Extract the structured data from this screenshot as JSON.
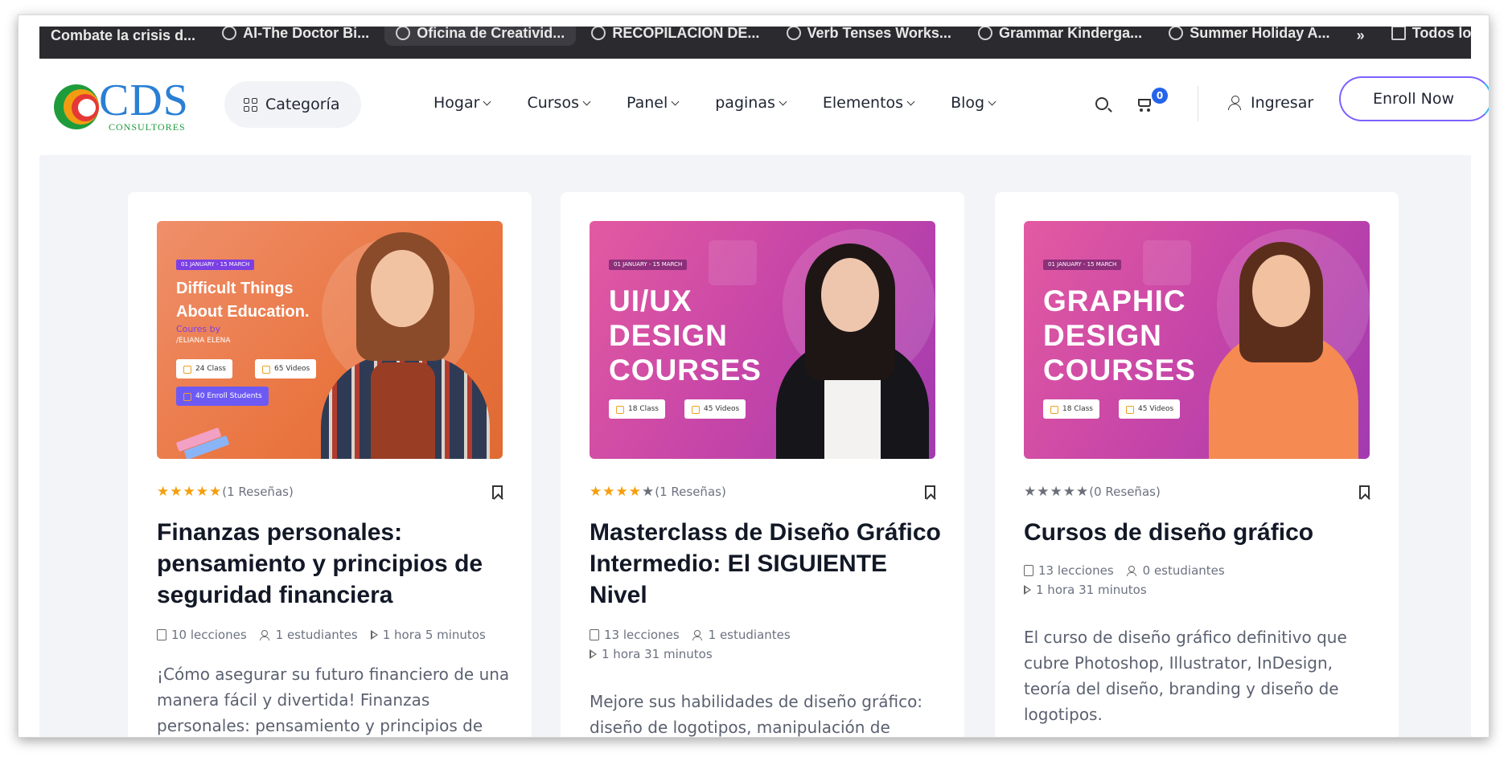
{
  "bookmarks": [
    {
      "label": "Combate la crisis d..."
    },
    {
      "label": "AI-The Doctor Bi..."
    },
    {
      "label": "Oficina de Creativid..."
    },
    {
      "label": "RECOPILACION DE..."
    },
    {
      "label": "Verb Tenses Works..."
    },
    {
      "label": "Grammar Kinderga..."
    },
    {
      "label": "Summer Holiday A..."
    },
    {
      "label": "»"
    },
    {
      "label": "Todos los f"
    }
  ],
  "header": {
    "logo_text": "CDS",
    "logo_sub": "CONSULTORES",
    "category_label": "Categoría",
    "nav": [
      "Hogar",
      "Cursos",
      "Panel",
      "paginas",
      "Elementos",
      "Blog"
    ],
    "cart_count": "0",
    "login_label": "Ingresar",
    "enroll_label": "Enroll Now"
  },
  "cards": [
    {
      "thumb": {
        "date": "01 JANUARY - 15 MARCH",
        "line1": "Difficult Things",
        "line2": "About Education.",
        "by": "Coures by",
        "author": "/ELIANA ELENA",
        "pill1": "24 Class",
        "pill2": "65 Videos",
        "pill3": "40 Enroll Students"
      },
      "rating": 5,
      "reviews": "(1 Reseñas)",
      "title": "Finanzas personales: pensamiento y principios de seguridad financiera",
      "lessons": "10 lecciones",
      "students": "1 estudiantes",
      "duration": "1 hora 5 minutos",
      "description": "¡Cómo asegurar su futuro financiero de una manera fácil y divertida! Finanzas personales: pensamiento y principios de"
    },
    {
      "thumb": {
        "date": "01 JANUARY - 15 MARCH",
        "l1": "UI/UX",
        "l2": "DESIGN",
        "l3": "COURSES",
        "pill1": "18 Class",
        "pill2": "45 Videos"
      },
      "rating": 4,
      "reviews": "(1 Reseñas)",
      "title": "Masterclass de Diseño Gráfico Intermedio: El SIGUIENTE Nivel",
      "lessons": "13 lecciones",
      "students": "1 estudiantes",
      "duration": "1 hora 31 minutos",
      "description": "Mejore sus habilidades de diseño gráfico: diseño de logotipos, manipulación de"
    },
    {
      "thumb": {
        "date": "01 JANUARY - 15 MARCH",
        "l1": "GRAPHIC",
        "l2": "DESIGN",
        "l3": "COURSES",
        "pill1": "18 Class",
        "pill2": "45 Videos"
      },
      "rating": 0,
      "reviews": "(0 Reseñas)",
      "title": "Cursos de diseño gráfico",
      "lessons": "13 lecciones",
      "students": "0 estudiantes",
      "duration": "1 hora 31 minutos",
      "description": "El curso de diseño gráfico definitivo que cubre Photoshop, Illustrator, InDesign, teoría del diseño, branding y diseño de logotipos."
    }
  ],
  "colors": {
    "accent": "#2563eb",
    "star": "#f59e0b",
    "orange_thumb": "#e9743f",
    "pink_thumb": "#c645a8"
  }
}
